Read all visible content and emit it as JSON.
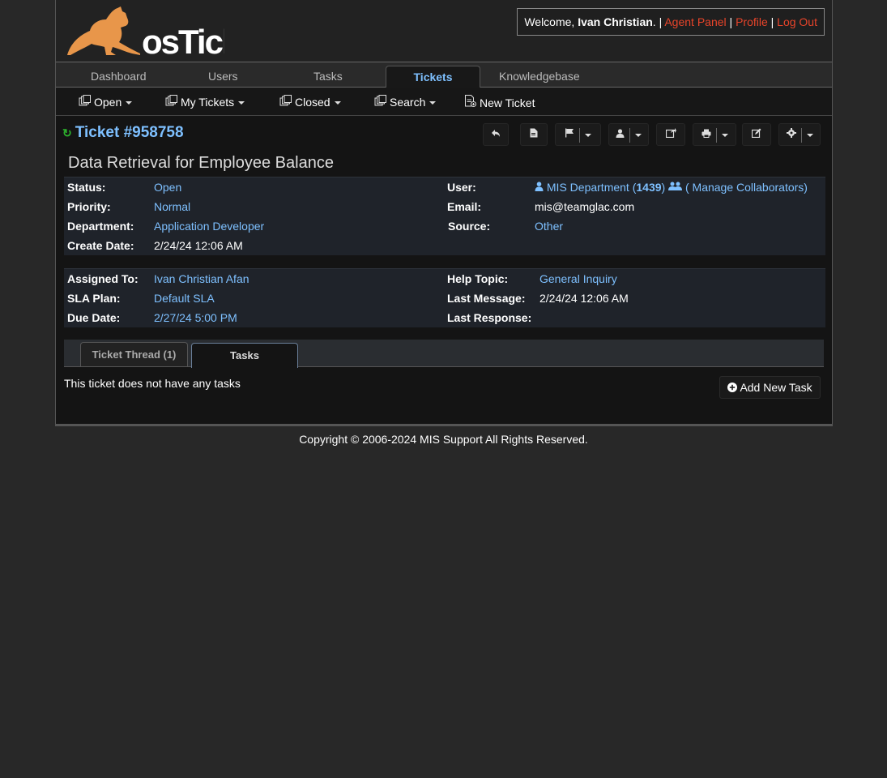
{
  "header": {
    "logo_text": "osTicket",
    "welcome_prefix": "Welcome, ",
    "user_name": "Ivan Christian",
    "welcome_suffix": ". | ",
    "agent_panel": "Agent Panel",
    "profile": "Profile",
    "logout": "Log Out",
    "separator": " | "
  },
  "nav": {
    "tabs": [
      {
        "label": "Dashboard"
      },
      {
        "label": "Users"
      },
      {
        "label": "Tasks"
      },
      {
        "label": "Tickets",
        "active": true
      },
      {
        "label": "Knowledgebase"
      }
    ]
  },
  "subnav": {
    "items": [
      {
        "label": "Open",
        "icon": "queue-icon"
      },
      {
        "label": "My Tickets",
        "icon": "queue-icon"
      },
      {
        "label": "Closed",
        "icon": "queue-icon"
      },
      {
        "label": "Search",
        "icon": "queue-icon"
      },
      {
        "label": "New Ticket",
        "icon": "new-ticket-icon"
      }
    ]
  },
  "ticket": {
    "number": "Ticket #958758",
    "subject": "Data Retrieval for Employee Balance",
    "actions": [
      "reply-icon",
      "note-icon",
      "flag-icon",
      "assign-icon",
      "transfer-icon",
      "print-icon",
      "edit-icon",
      "settings-icon"
    ]
  },
  "info1": {
    "status_label": "Status:",
    "status": "Open",
    "priority_label": "Priority:",
    "priority": "Normal",
    "department_label": "Department:",
    "department": "Application Developer",
    "create_label": "Create Date:",
    "create": "2/24/24 12:06 AM",
    "user_label": "User:",
    "user": "MIS Department (",
    "user_count": "1439",
    "user_close": ")",
    "collab": "( Manage Collaborators)",
    "email_label": "Email:",
    "email": "mis@teamglac.com",
    "source_label": "Source:",
    "source": "Other"
  },
  "info2": {
    "assigned_label": "Assigned To:",
    "assigned": "Ivan Christian Afan",
    "sla_label": "SLA Plan:",
    "sla": "Default SLA",
    "due_label": "Due Date:",
    "due": "2/27/24 5:00 PM",
    "topic_label": "Help Topic:",
    "topic": "General Inquiry",
    "lastmsg_label": "Last Message:",
    "lastmsg": "2/24/24 12:06 AM",
    "lastresp_label": "Last Response:",
    "lastresp": ""
  },
  "tabs": {
    "thread": "Ticket Thread (1)",
    "tasks": "Tasks"
  },
  "tasks": {
    "empty": "This ticket does not have any tasks",
    "add": "Add New Task"
  },
  "footer": "Copyright © 2006-2024 MIS Support All Rights Reserved.",
  "colors": {
    "link": "#7ec0ff",
    "accent_link": "#e8442a",
    "refresh": "#2db32d"
  }
}
